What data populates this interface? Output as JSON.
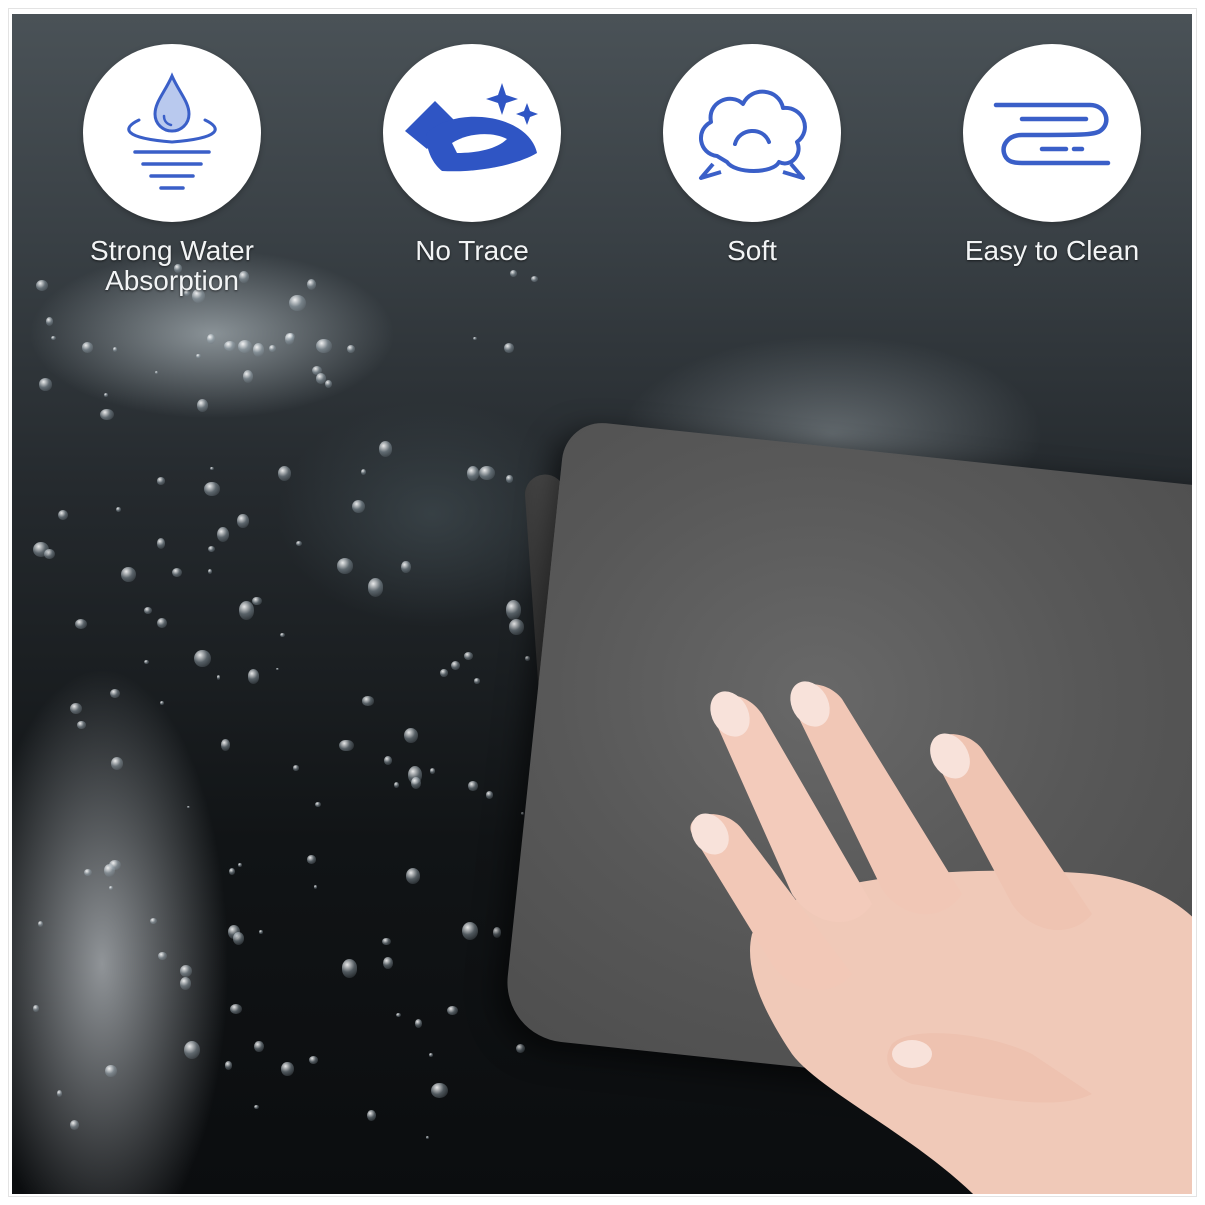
{
  "features": [
    {
      "label": "Strong Water Absorption",
      "label_line1": "Strong Water",
      "label_line2": "Absorption",
      "icon": "water-drop-absorption-icon"
    },
    {
      "label": "No Trace",
      "icon": "hand-wiping-sparkle-icon"
    },
    {
      "label": "Soft",
      "icon": "cotton-cloud-icon"
    },
    {
      "label": "Easy to Clean",
      "icon": "flowing-lines-icon"
    }
  ],
  "colors": {
    "icon_blue": "#3a5fc8",
    "icon_circle": "#ffffff",
    "towel_gray": "#5a5a5a",
    "label_text": "#f2f4f5"
  }
}
